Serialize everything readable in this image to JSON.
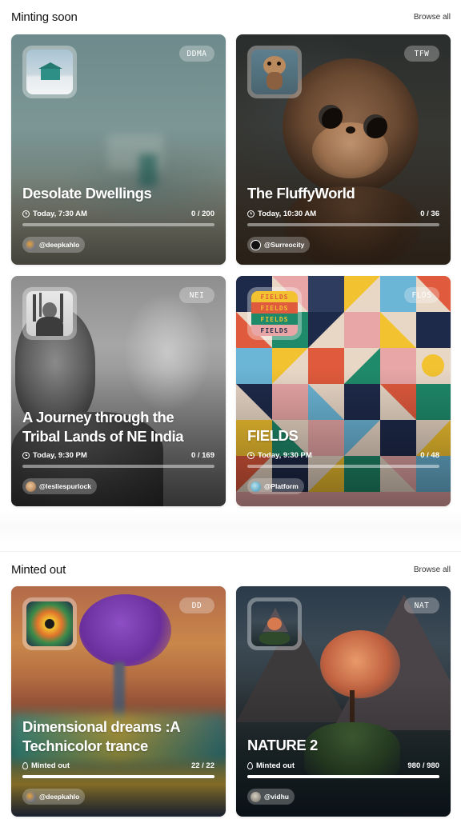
{
  "sections": [
    {
      "title": "Minting soon",
      "browse_label": "Browse all"
    },
    {
      "title": "Minted out",
      "browse_label": "Browse all"
    }
  ],
  "cards": [
    {
      "title_lines": [
        "Desolate Dwellings"
      ],
      "tag": "DDMA",
      "time": "Today, 7:30 AM",
      "count": "0 / 200",
      "progress": 0,
      "creator": "@deepkahlo",
      "status_icon": "clock-icon"
    },
    {
      "title_lines": [
        "The FluffyWorld"
      ],
      "tag": "TFW",
      "time": "Today, 10:30 AM",
      "count": "0 / 36",
      "progress": 0,
      "creator": "@Surreocity",
      "status_icon": "clock-icon"
    },
    {
      "title_lines": [
        "A Journey through the",
        "Tribal Lands of NE India"
      ],
      "tag": "NEI",
      "time": "Today, 9:30 PM",
      "count": "0 / 169",
      "progress": 0,
      "creator": "@lesliespurlock",
      "status_icon": "clock-icon"
    },
    {
      "title_lines": [
        "FIELDS"
      ],
      "tag": "FLDS",
      "time": "Today, 9:30 PM",
      "count": "0 / 48",
      "progress": 0,
      "creator": "@Platform",
      "status_icon": "clock-icon",
      "thumb_words": [
        "FIELDS",
        "FIELDS",
        "FIELDS",
        "FIELDS"
      ]
    },
    {
      "title_lines": [
        "Dimensional dreams :A",
        "Technicolor trance"
      ],
      "tag": "DD",
      "time": "Minted out",
      "count": "22 / 22",
      "progress": 1,
      "creator": "@deepkahlo",
      "status_icon": "flame-icon"
    },
    {
      "title_lines": [
        "NATURE 2"
      ],
      "tag": "NAT",
      "time": "Minted out",
      "count": "980 / 980",
      "progress": 1,
      "creator": "@vidhu",
      "status_icon": "flame-icon"
    }
  ]
}
